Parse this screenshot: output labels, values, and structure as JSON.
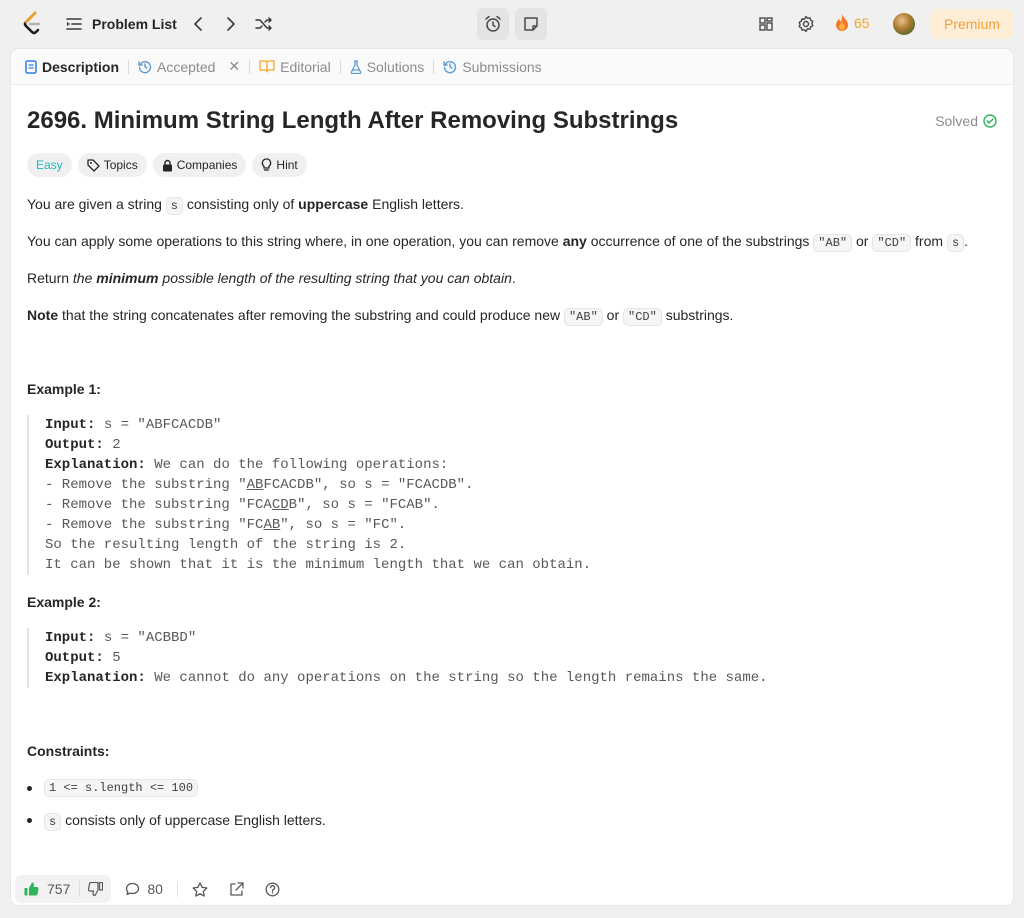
{
  "topbar": {
    "problem_list_label": "Problem List",
    "streak_count": "65",
    "premium_label": "Premium"
  },
  "tabs": [
    {
      "label": "Description"
    },
    {
      "label": "Accepted"
    },
    {
      "label": "Editorial"
    },
    {
      "label": "Solutions"
    },
    {
      "label": "Submissions"
    }
  ],
  "problem": {
    "title": "2696. Minimum String Length After Removing Substrings",
    "status": "Solved",
    "tags": {
      "difficulty": "Easy",
      "topics": "Topics",
      "companies": "Companies",
      "hint": "Hint"
    },
    "p1": {
      "a": "You are given a string ",
      "code": "s",
      "b": " consisting only of ",
      "bold": "uppercase",
      "c": " English letters."
    },
    "p2": {
      "a": "You can apply some operations to this string where, in one operation, you can remove ",
      "bold": "any",
      "b": " occurrence of one of the substrings ",
      "code1": "\"AB\"",
      "c": " or ",
      "code2": "\"CD\"",
      "d": " from ",
      "code3": "s",
      "e": "."
    },
    "p3": {
      "a": "Return ",
      "i1": "the ",
      "bi": "minimum",
      "i2": " possible length of the resulting string that you can obtain",
      "e": "."
    },
    "p4": {
      "bold": "Note",
      "a": " that the string concatenates after removing the substring and could produce new ",
      "code1": "\"AB\"",
      "b": " or ",
      "code2": "\"CD\"",
      "c": " substrings."
    },
    "example1": {
      "heading": "Example 1:",
      "input_label": "Input:",
      "input_value": " s = \"ABFCACDB\"",
      "output_label": "Output:",
      "output_value": " 2",
      "explanation_label": "Explanation:",
      "explanation_value": " We can do the following operations:",
      "l1a": "- Remove the substring \"",
      "l1u": "AB",
      "l1b": "FCACDB\", so s = \"FCACDB\".",
      "l2a": "- Remove the substring \"FCA",
      "l2u": "CD",
      "l2b": "B\", so s = \"FCAB\".",
      "l3a": "- Remove the substring \"FC",
      "l3u": "AB",
      "l3b": "\", so s = \"FC\".",
      "l4": "So the resulting length of the string is 2.",
      "l5": "It can be shown that it is the minimum length that we can obtain."
    },
    "example2": {
      "heading": "Example 2:",
      "input_label": "Input:",
      "input_value": " s = \"ACBBD\"",
      "output_label": "Output:",
      "output_value": " 5",
      "explanation_label": "Explanation:",
      "explanation_value": " We cannot do any operations on the string so the length remains the same."
    },
    "constraints": {
      "heading": "Constraints:",
      "c1": "1 <= s.length <= 100",
      "c2_code": "s",
      "c2_text": " consists only of uppercase English letters."
    }
  },
  "footer": {
    "likes": "757",
    "comments": "80"
  },
  "colors": {
    "accent_orange": "#f5a623",
    "easy": "#1cbaba",
    "solved": "#2db55d",
    "like_green": "#2db55d"
  }
}
